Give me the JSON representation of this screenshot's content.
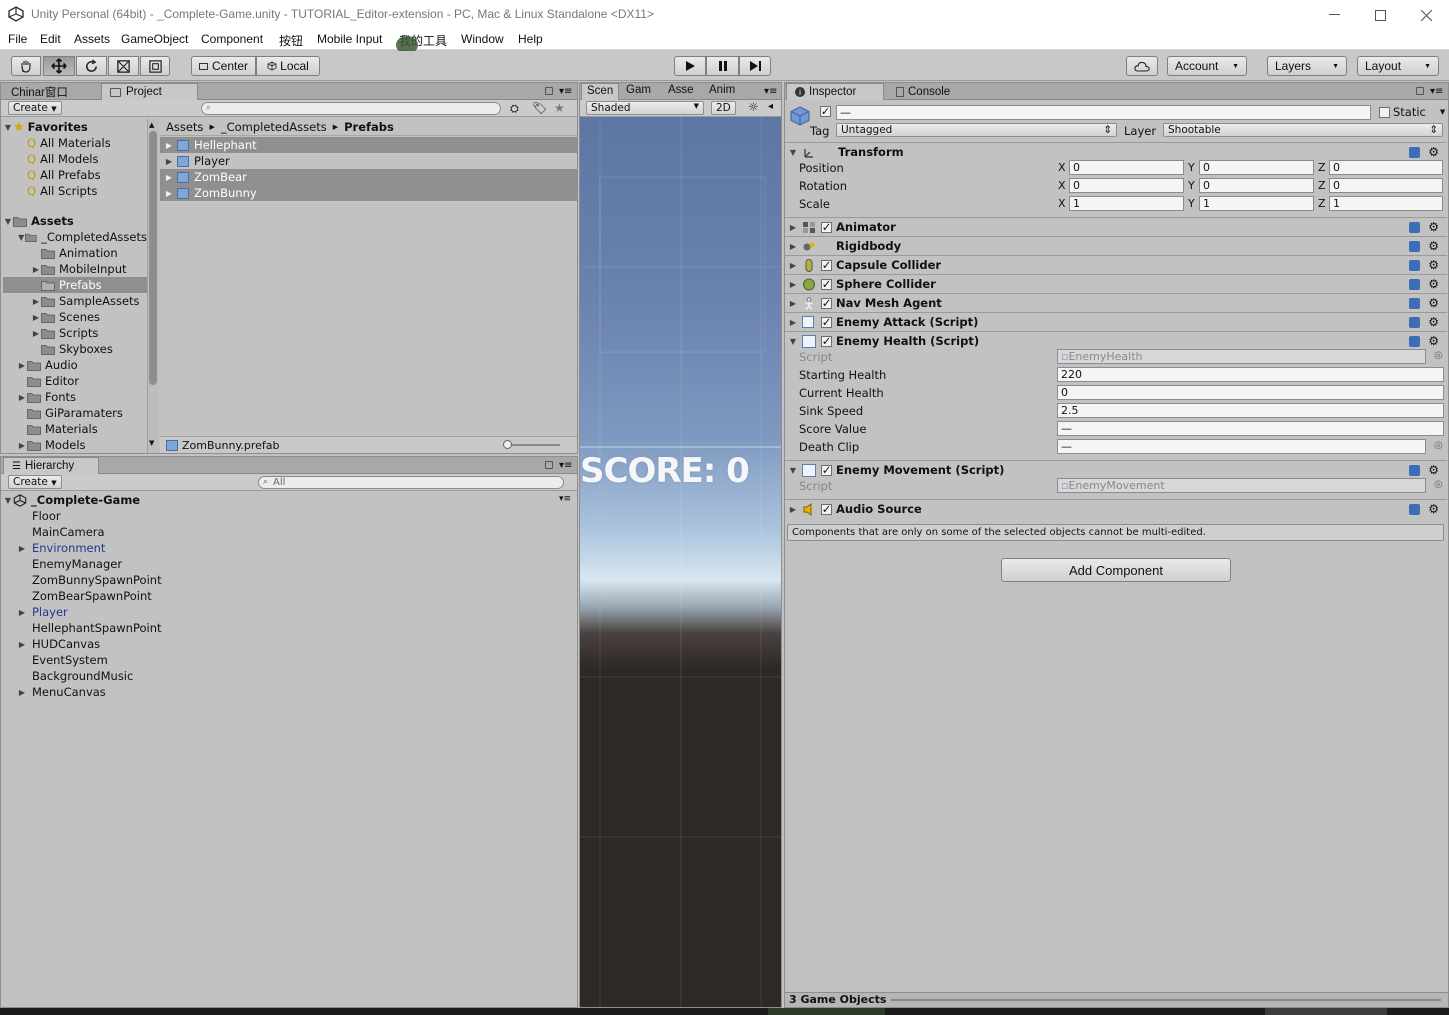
{
  "window": {
    "title": "Unity Personal (64bit) - _Complete-Game.unity - TUTORIAL_Editor-extension - PC, Mac & Linux Standalone <DX11>"
  },
  "menu": [
    "File",
    "Edit",
    "Assets",
    "GameObject",
    "Component",
    "按钮",
    "Mobile Input",
    "我的工具",
    "Window",
    "Help"
  ],
  "toolbar": {
    "center_label": "Center",
    "local_label": "Local",
    "account_label": "Account",
    "layers_label": "Layers",
    "layout_label": "Layout"
  },
  "project": {
    "tab_chinar": "Chinar窗口",
    "tab_project": "Project",
    "create_label": "Create",
    "favorites_label": "Favorites",
    "favorites": [
      "All Materials",
      "All Models",
      "All Prefabs",
      "All Scripts"
    ],
    "assets_label": "Assets",
    "completed_label": "_CompletedAssets",
    "completed_children": [
      "Animation",
      "MobileInput",
      "Prefabs",
      "SampleAssets",
      "Scenes",
      "Scripts",
      "Skyboxes"
    ],
    "asset_folders": [
      "Audio",
      "Editor",
      "Fonts",
      "GiParamaters",
      "Materials",
      "Models"
    ],
    "breadcrumb": [
      "Assets",
      "_CompletedAssets",
      "Prefabs"
    ],
    "prefabs": [
      "Hellephant",
      "Player",
      "ZomBear",
      "ZomBunny"
    ],
    "selected_file": "ZomBunny.prefab"
  },
  "hierarchy": {
    "tab": "Hierarchy",
    "create_label": "Create",
    "search_placeholder": "All",
    "scene_name": "_Complete-Game",
    "items": [
      {
        "name": "Floor",
        "expandable": false,
        "prefab": false
      },
      {
        "name": "MainCamera",
        "expandable": false,
        "prefab": false
      },
      {
        "name": "Environment",
        "expandable": true,
        "prefab": true
      },
      {
        "name": "EnemyManager",
        "expandable": false,
        "prefab": false
      },
      {
        "name": "ZomBunnySpawnPoint",
        "expandable": false,
        "prefab": false
      },
      {
        "name": "ZomBearSpawnPoint",
        "expandable": false,
        "prefab": false
      },
      {
        "name": "Player",
        "expandable": true,
        "prefab": true
      },
      {
        "name": "HellephantSpawnPoint",
        "expandable": false,
        "prefab": false
      },
      {
        "name": "HUDCanvas",
        "expandable": true,
        "prefab": false
      },
      {
        "name": "EventSystem",
        "expandable": false,
        "prefab": false
      },
      {
        "name": "BackgroundMusic",
        "expandable": false,
        "prefab": false
      },
      {
        "name": "MenuCanvas",
        "expandable": true,
        "prefab": false
      }
    ]
  },
  "scene": {
    "tabs": [
      "Scen",
      "Gam",
      "Asse",
      "Anim"
    ],
    "shaded_label": "Shaded",
    "mode_2d": "2D",
    "score_text": "SCORE: 0"
  },
  "inspector": {
    "tab_inspector": "Inspector",
    "tab_console": "Console",
    "name_value": "—",
    "static_label": "Static",
    "tag_label": "Tag",
    "tag_value": "Untagged",
    "layer_label": "Layer",
    "layer_value": "Shootable",
    "transform": {
      "title": "Transform",
      "position_label": "Position",
      "position": [
        "0",
        "0",
        "0"
      ],
      "rotation_label": "Rotation",
      "rotation": [
        "0",
        "0",
        "0"
      ],
      "scale_label": "Scale",
      "scale": [
        "1",
        "1",
        "1"
      ]
    },
    "components": [
      "Animator",
      "Rigidbody",
      "Capsule Collider",
      "Sphere Collider",
      "Nav Mesh Agent",
      "Enemy Attack (Script)"
    ],
    "enemy_health": {
      "title": "Enemy Health (Script)",
      "script_label": "Script",
      "script_value": "EnemyHealth",
      "starting_health_label": "Starting Health",
      "starting_health": "220",
      "current_health_label": "Current Health",
      "current_health": "0",
      "sink_speed_label": "Sink Speed",
      "sink_speed": "2.5",
      "score_value_label": "Score Value",
      "score_value": "—",
      "death_clip_label": "Death Clip",
      "death_clip": "—"
    },
    "enemy_movement": {
      "title": "Enemy Movement (Script)",
      "script_label": "Script",
      "script_value": "EnemyMovement"
    },
    "audio_source": "Audio Source",
    "multi_edit_note": "Components that are only on some of the selected objects cannot be multi-edited.",
    "add_component_label": "Add Component",
    "status": "3 Game Objects"
  },
  "colors": {
    "panel_bg": "#c2c2c2",
    "selection": "#8f8f8f",
    "prefab_text": "#1f3b8a",
    "scene_sky_top": "#5f78a6",
    "scene_ground": "#2e2827"
  }
}
